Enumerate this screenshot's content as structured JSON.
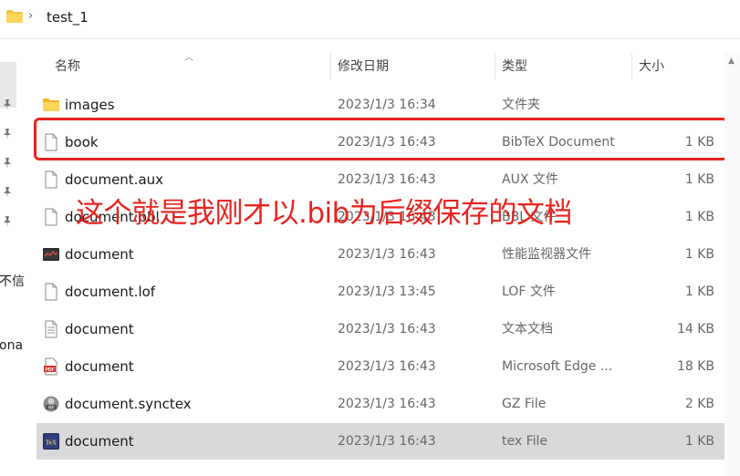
{
  "breadcrumb": {
    "chevron": "›",
    "folder": "test_1"
  },
  "nav": {
    "fragments": [
      "不信",
      "ona"
    ]
  },
  "columns": {
    "name": "名称",
    "date": "修改日期",
    "type": "类型",
    "size": "大小"
  },
  "files": [
    {
      "icon": "folder-icon",
      "name": "images",
      "date": "2023/1/3 16:34",
      "type": "文件夹",
      "size": ""
    },
    {
      "icon": "blank-file-icon",
      "name": "book",
      "date": "2023/1/3 16:43",
      "type": "BibTeX Document",
      "size": "1 KB"
    },
    {
      "icon": "blank-file-icon",
      "name": "document.aux",
      "date": "2023/1/3 16:43",
      "type": "AUX 文件",
      "size": "1 KB"
    },
    {
      "icon": "blank-file-icon",
      "name": "document.bbl",
      "date": "2023/1/3 16:43",
      "type": "BBL 文件",
      "size": "1 KB"
    },
    {
      "icon": "monitor-file-icon",
      "name": "document",
      "date": "2023/1/3 16:43",
      "type": "性能监视器文件",
      "size": "1 KB"
    },
    {
      "icon": "blank-file-icon",
      "name": "document.lof",
      "date": "2023/1/3 13:45",
      "type": "LOF 文件",
      "size": "1 KB"
    },
    {
      "icon": "text-file-icon",
      "name": "document",
      "date": "2023/1/3 16:43",
      "type": "文本文档",
      "size": "14 KB"
    },
    {
      "icon": "pdf-file-icon",
      "name": "document",
      "date": "2023/1/3 16:43",
      "type": "Microsoft Edge ...",
      "size": "18 KB"
    },
    {
      "icon": "gz-file-icon",
      "name": "document.synctex",
      "date": "2023/1/3 16:43",
      "type": "GZ File",
      "size": "2 KB"
    },
    {
      "icon": "tex-file-icon",
      "name": "document",
      "date": "2023/1/3 16:43",
      "type": "tex File",
      "size": "1 KB"
    }
  ],
  "annotation": {
    "text": "这个就是我刚才以.bib为后缀保存的文档",
    "color": "#e8241f"
  },
  "colors": {
    "accent_red": "#e8241f",
    "selected_row": "#d9d9d9",
    "folder": "#f5c342"
  }
}
